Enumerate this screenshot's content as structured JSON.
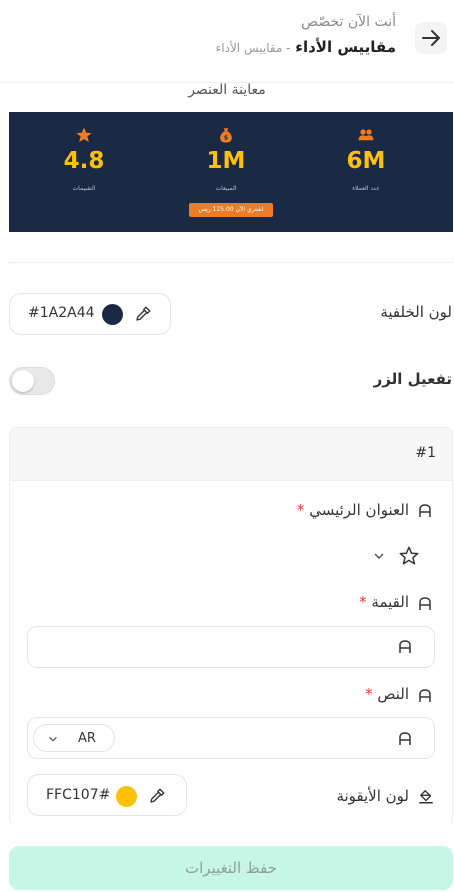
{
  "header": {
    "subtitle": "أنت الآن تخصّص",
    "title": "مقاييس الأداء",
    "breadcrumb": "- مقاييس الأداء"
  },
  "preview": {
    "title": "معاينة العنصر",
    "stats": [
      {
        "value": "6M",
        "label": "عدد العملاء",
        "icon": "users-icon"
      },
      {
        "value": "1M",
        "label": "المبيعات",
        "icon": "money-bag-icon"
      },
      {
        "value": "4.8",
        "label": "التقييمات",
        "icon": "star-icon"
      }
    ],
    "cta": "اشتري الآن 125.00 ريس"
  },
  "background_color": {
    "label": "لون الخلفية",
    "value": "#1A2A44",
    "color": "#1A2A44"
  },
  "button_toggle": {
    "label": "تفعيل الزر"
  },
  "item": {
    "number": "#1",
    "main_title_label": "العنوان الرئيسي",
    "value_label": "القيمة",
    "text_label": "النص",
    "required_mark": "*",
    "language": "AR",
    "icon_color_label": "لون الأيقونة",
    "icon_color_value": "FFC107#",
    "icon_color": "#FFC107"
  },
  "save_button": "حفظ التغييرات",
  "colors": {
    "accent": "#FFC107",
    "banner_bg": "#1A2A44",
    "cta_bg": "#f07c22",
    "save_bg": "#c7f5e6"
  }
}
